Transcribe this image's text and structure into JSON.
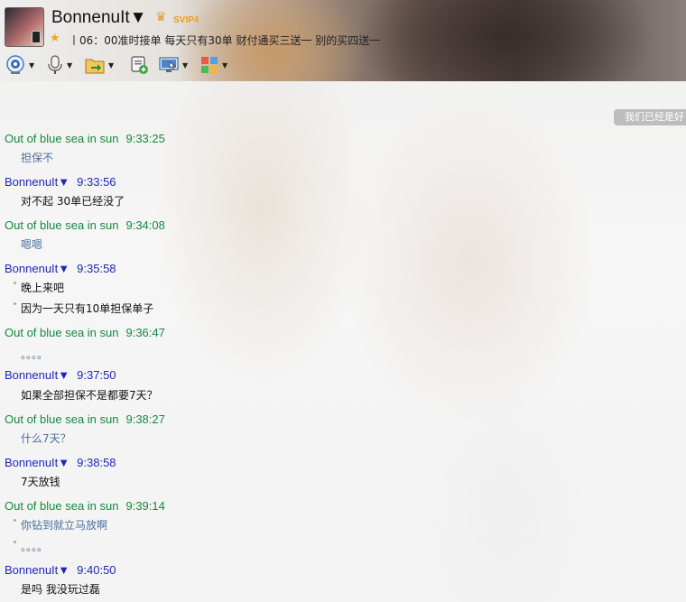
{
  "header": {
    "nickname": "BonnenuIt▼",
    "vip_badge": "SVIP4",
    "signature": "丨06：00准时接单 每天只有30单 财付通买三送一 别的买四送一",
    "toolbar_icons": [
      "webcam-icon",
      "microphone-icon",
      "folder-transfer-icon",
      "message-add-icon",
      "screen-share-icon",
      "apps-grid-icon"
    ]
  },
  "notice": "我们已经是好",
  "chat": [
    {
      "type": "sender",
      "who": "other",
      "name": "Out of blue sea in sun",
      "time": "9:33:25"
    },
    {
      "type": "msg",
      "who": "other",
      "text": "担保不"
    },
    {
      "type": "sender",
      "who": "me",
      "name": "BonnenuIt▼",
      "time": "9:33:56"
    },
    {
      "type": "msg",
      "who": "me",
      "text": "对不起 30单已经没了"
    },
    {
      "type": "sender",
      "who": "other",
      "name": "Out of blue sea in sun",
      "time": "9:34:08"
    },
    {
      "type": "msg",
      "who": "other",
      "text": "嗯嗯"
    },
    {
      "type": "sender",
      "who": "me",
      "name": "BonnenuIt▼",
      "time": "9:35:58"
    },
    {
      "type": "msg",
      "who": "me",
      "text": "晚上来吧",
      "bullet": true
    },
    {
      "type": "msg",
      "who": "me",
      "text": "因为一天只有10单担保单子",
      "bullet": true
    },
    {
      "type": "sender",
      "who": "other",
      "name": "Out of blue sea in sun",
      "time": "9:36:47"
    },
    {
      "type": "msg",
      "who": "other",
      "text": "。。。。"
    },
    {
      "type": "sender",
      "who": "me",
      "name": "BonnenuIt▼",
      "time": "9:37:50"
    },
    {
      "type": "msg",
      "who": "me",
      "text": "如果全部担保不是都要7天？"
    },
    {
      "type": "sender",
      "who": "other",
      "name": "Out of blue sea in sun",
      "time": "9:38:27"
    },
    {
      "type": "msg",
      "who": "other",
      "text": "什么7天？"
    },
    {
      "type": "sender",
      "who": "me",
      "name": "BonnenuIt▼",
      "time": "9:38:58"
    },
    {
      "type": "msg",
      "who": "me",
      "text": "7天放钱"
    },
    {
      "type": "sender",
      "who": "other",
      "name": "Out of blue sea in sun",
      "time": "9:39:14"
    },
    {
      "type": "msg",
      "who": "other",
      "text": "你钻到就立马放啊",
      "bullet": true
    },
    {
      "type": "msg",
      "who": "other",
      "text": "。。。。",
      "bullet": true
    },
    {
      "type": "sender",
      "who": "me",
      "name": "BonnenuIt▼",
      "time": "9:40:50"
    },
    {
      "type": "msg",
      "who": "me",
      "text": "是吗 我没玩过磊"
    }
  ],
  "colors": {
    "other_sender": "#138a3c",
    "me_sender": "#1f28b8",
    "other_text": "#4d6e9c",
    "me_text": "#111111"
  }
}
